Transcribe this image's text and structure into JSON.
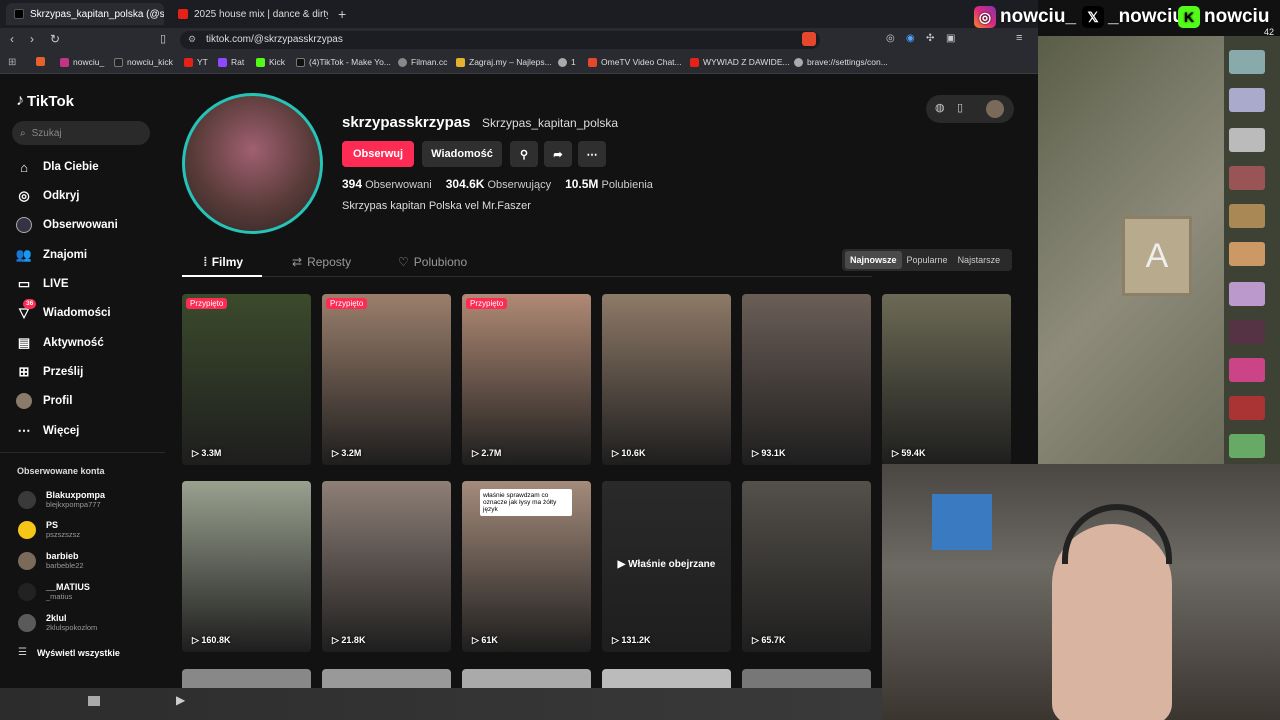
{
  "browser": {
    "tabs": [
      {
        "title": "Skrzypas_kapitan_polska (@skrz",
        "active": true
      },
      {
        "title": "2025 house mix | dance & dirty g",
        "active": false
      }
    ],
    "url": "tiktok.com/@skrzypasskrzypas",
    "bookmarks": [
      "nowciu_",
      "nowciu_kick",
      "YT",
      "Rat",
      "Kick",
      "(4)TikTok - Make Yo...",
      "Filman.cc",
      "Zagraj.my – Najleps...",
      "1",
      "OmeTV Video Chat...",
      "WYWIAD Z DAWIDE...",
      "brave://settings/con..."
    ]
  },
  "sidebar": {
    "logo": "TikTok",
    "search_placeholder": "Szukaj",
    "nav": [
      {
        "label": "Dla Ciebie",
        "icon": "home-icon"
      },
      {
        "label": "Odkryj",
        "icon": "compass-icon"
      },
      {
        "label": "Obserwowani",
        "icon": "following-icon"
      },
      {
        "label": "Znajomi",
        "icon": "friends-icon"
      },
      {
        "label": "LIVE",
        "icon": "live-icon"
      },
      {
        "label": "Wiadomości",
        "icon": "messages-icon",
        "badge": "36"
      },
      {
        "label": "Aktywność",
        "icon": "activity-icon"
      },
      {
        "label": "Prześlij",
        "icon": "upload-icon"
      },
      {
        "label": "Profil",
        "icon": "profile-icon"
      },
      {
        "label": "Więcej",
        "icon": "more-icon"
      }
    ],
    "followed_title": "Obserwowane konta",
    "accounts": [
      {
        "name": "Blakuxpompa",
        "handle": "blejkxpompa777"
      },
      {
        "name": "PS",
        "handle": "pszszszsz"
      },
      {
        "name": "barbieb",
        "handle": "barbeble22"
      },
      {
        "name": "__MATIUS",
        "handle": "_matius"
      },
      {
        "name": "2klul",
        "handle": "2klulspokozlom"
      }
    ],
    "show_all": "Wyświetl wszystkie"
  },
  "profile": {
    "username": "skrzypasskrzypas",
    "nickname": "Skrzypas_kapitan_polska",
    "follow": "Obserwuj",
    "message": "Wiadomość",
    "stats": [
      {
        "value": "394",
        "label": "Obserwowani"
      },
      {
        "value": "304.6K",
        "label": "Obserwujący"
      },
      {
        "value": "10.5M",
        "label": "Polubienia"
      }
    ],
    "bio": "Skrzypas kapitan Polska vel Mr.Faszer"
  },
  "tabs": [
    "Filmy",
    "Reposty",
    "Polubiono"
  ],
  "sort": [
    "Najnowsze",
    "Popularne",
    "Najstarsze"
  ],
  "videos": [
    {
      "views": "3.3M",
      "pinned": "Przypięto",
      "bg": "#3b4a2c"
    },
    {
      "views": "3.2M",
      "pinned": "Przypięto",
      "bg": "#9b7f6c"
    },
    {
      "views": "2.7M",
      "pinned": "Przypięto",
      "bg": "#b08a75"
    },
    {
      "views": "10.6K",
      "pinned": "",
      "bg": "#8e7a68"
    },
    {
      "views": "93.1K",
      "pinned": "",
      "bg": "#6b5e57"
    },
    {
      "views": "59.4K",
      "pinned": "",
      "bg": "#6c6a55"
    },
    {
      "views": "160.8K",
      "pinned": "",
      "bg": "#9aa18f"
    },
    {
      "views": "21.8K",
      "pinned": "",
      "bg": "#8e7f77"
    },
    {
      "views": "61K",
      "pinned": "",
      "bg": "#a48b7b",
      "caption": "właśnie sprawdzam co oznacze jak łysy ma żółty język"
    },
    {
      "views": "131.2K",
      "pinned": "",
      "bg": "#2a2a2a",
      "overlay": "Właśnie obejrzane"
    },
    {
      "views": "65.7K",
      "pinned": "",
      "bg": "#54504a"
    }
  ],
  "stream": {
    "instagram": "nowciu_",
    "x": "_nowciu",
    "kick": "nowciu",
    "viewers": "42"
  }
}
